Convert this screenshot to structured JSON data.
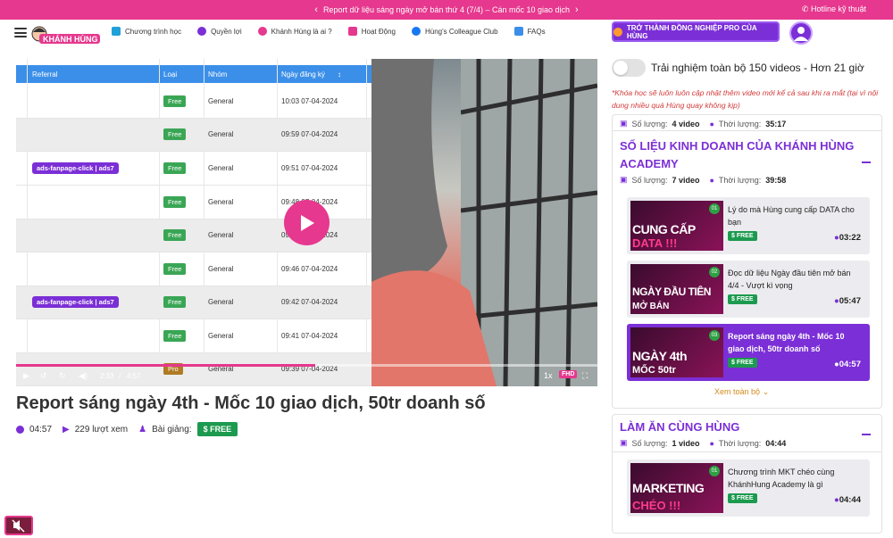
{
  "topbar": {
    "announcement": "Report dữ liệu sáng ngày mở bán thứ 4 (7/4) – Cán mốc 10 giao dịch",
    "prev": "‹",
    "next": "›",
    "hotline": "Hotline kỹ thuật"
  },
  "nav": {
    "brand": "KHÁNH HÙNG",
    "items": [
      {
        "label": "Chương trình học",
        "icon": "video-icon",
        "color": "#20a0d8"
      },
      {
        "label": "Quyền lợi",
        "icon": "gift-icon",
        "color": "#7b2fd6"
      },
      {
        "label": "Khánh Hùng là ai ?",
        "icon": "people-icon",
        "color": "#e6388e"
      },
      {
        "label": "Hoạt Động",
        "icon": "calendar-icon",
        "color": "#e6388e"
      },
      {
        "label": "Hùng's Colleague Club",
        "icon": "facebook-icon",
        "color": "#1877f2"
      },
      {
        "label": "FAQs",
        "icon": "chat-icon",
        "color": "#3b8fe8"
      }
    ],
    "pro_button": "TRỞ THÀNH ĐỒNG NGHIỆP PRO CỦA HÙNG"
  },
  "sheet": {
    "headers": [
      "Referral",
      "Loại",
      "Nhóm",
      "Ngày đăng ký"
    ],
    "rows": [
      {
        "ref": "",
        "type": "Free",
        "group": "General",
        "date": "10:03 07-04-2024"
      },
      {
        "ref": "",
        "type": "Free",
        "group": "General",
        "date": "09:59 07-04-2024"
      },
      {
        "ref": "ads-fanpage-click | ads7",
        "type": "Free",
        "group": "General",
        "date": "09:51 07-04-2024"
      },
      {
        "ref": "",
        "type": "Free",
        "group": "General",
        "date": "09:48 07-04-2024"
      },
      {
        "ref": "",
        "type": "Free",
        "group": "General",
        "date": "09:47 07-04-2024"
      },
      {
        "ref": "",
        "type": "Free",
        "group": "General",
        "date": "09:46 07-04-2024"
      },
      {
        "ref": "ads-fanpage-click | ads7",
        "type": "Free",
        "group": "General",
        "date": "09:42 07-04-2024"
      },
      {
        "ref": "",
        "type": "Free",
        "group": "General",
        "date": "09:41 07-04-2024"
      },
      {
        "ref": "",
        "type": "Pro",
        "group": "General",
        "date": "09:39 07-04-2024"
      }
    ]
  },
  "player": {
    "current_time": "2:33",
    "separator": "/",
    "duration": "4:57",
    "progress": 0.515,
    "speed": "1x",
    "quality": "FHD"
  },
  "video": {
    "title": "Report sáng ngày 4th - Mốc 10 giao dịch, 50tr doanh số",
    "duration": "04:57",
    "views": "229 lượt xem",
    "lesson_label": "Bài giảng:",
    "free": "FREE"
  },
  "sidebar": {
    "toggle_label": "Trải nghiệm toàn bộ 150 videos - Hơn 21 giờ",
    "note": "*Khóa học sẽ luôn luôn cập nhật thêm video mới kể cả sau khi ra mắt (tại vì nội dung nhiều quá Hùng quay không kịp)",
    "prev_section_meta": {
      "count_label": "Số lượng:",
      "count": "4 video",
      "time_label": "Thời lượng:",
      "time": "35:17"
    },
    "sections": [
      {
        "title": "SỐ LIỆU KINH DOANH CỦA KHÁNH HÙNG ACADEMY",
        "count_label": "Số lượng:",
        "count": "7 video",
        "time_label": "Thời lượng:",
        "time": "39:58",
        "lessons": [
          {
            "num": "01",
            "thumb1": "CUNG CẤP",
            "thumb2": "DATA !!!",
            "title": "Lý do mà Hùng cung cấp DATA cho bạn",
            "free": "FREE",
            "duration": "03:22",
            "active": false
          },
          {
            "num": "02",
            "thumb1": "NGÀY ĐẦU TIÊN",
            "thumb2": "MỞ BÁN",
            "title": "Đọc dữ liệu Ngày đầu tiên mở bán 4/4 - Vượt kì vọng",
            "free": "FREE",
            "duration": "05:47",
            "active": false
          },
          {
            "num": "03",
            "thumb1": "NGÀY 4th",
            "thumb2": "MỐC 50tr",
            "title": "Report sáng ngày 4th - Mốc 10 giao dịch, 50tr doanh số",
            "free": "FREE",
            "duration": "04:57",
            "active": true
          }
        ],
        "see_all": "Xem toàn bộ"
      },
      {
        "title": "LÀM ĂN CÙNG HÙNG",
        "count_label": "Số lượng:",
        "count": "1 video",
        "time_label": "Thời lượng:",
        "time": "04:44",
        "lessons": [
          {
            "num": "01",
            "thumb1": "MARKETING",
            "thumb2": "CHÉO !!!",
            "title": "Chương trình MKT chéo cùng KhánhHung Academy là gì",
            "free": "FREE",
            "duration": "04:44",
            "active": false
          }
        ]
      }
    ]
  },
  "colors": {
    "brand_pink": "#e6388e",
    "brand_purple": "#7b2fd6",
    "free_green": "#1c9a4f",
    "sheet_blue": "#3b8fe8"
  }
}
